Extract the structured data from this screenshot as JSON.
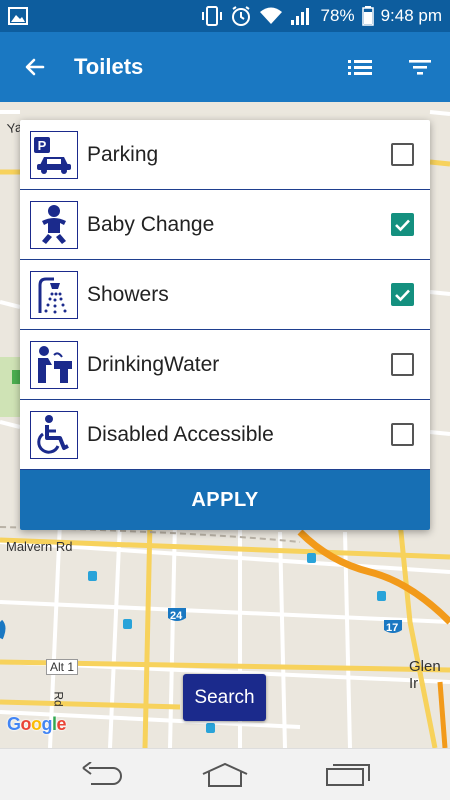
{
  "status_bar": {
    "battery": "78%",
    "time": "9:48 pm"
  },
  "app_bar": {
    "title": "Toilets"
  },
  "filters": [
    {
      "label": "Parking",
      "icon": "parking-icon",
      "checked": false
    },
    {
      "label": "Baby Change",
      "icon": "baby-change-icon",
      "checked": true
    },
    {
      "label": "Showers",
      "icon": "shower-icon",
      "checked": true
    },
    {
      "label": "DrinkingWater",
      "icon": "drinking-water-icon",
      "checked": false
    },
    {
      "label": "Disabled Accessible",
      "icon": "wheelchair-icon",
      "checked": false
    }
  ],
  "apply_label": "APPLY",
  "search_label": "Search",
  "map": {
    "labels": {
      "malvern": "Malvern Rd",
      "alt": "Alt 1",
      "glen": "Glen Ir",
      "rd": "Rd",
      "yar": "Yar",
      "shield_24": "24",
      "shield_17": "17"
    },
    "google": "Google"
  },
  "colors": {
    "status_bar": "#0d5d9e",
    "app_bar": "#1a78c2",
    "checkbox_checked": "#14907f",
    "apply": "#176fb4",
    "search": "#1b2a8c"
  }
}
